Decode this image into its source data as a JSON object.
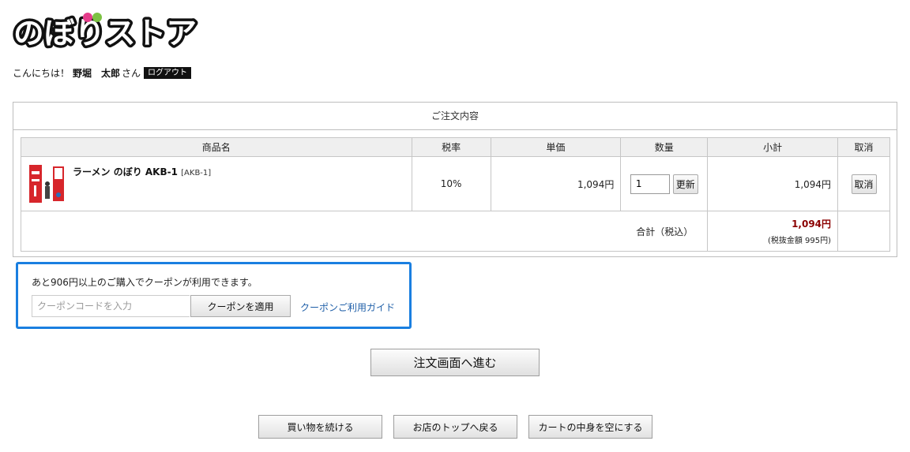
{
  "brand": {
    "logo_text": "のぼりストア"
  },
  "greeting": {
    "hello": "こんにちは！",
    "user_name": "野堀　太郎",
    "suffix": "さん",
    "logout_label": "ログアウト"
  },
  "order": {
    "section_title": "ご注文内容",
    "columns": [
      "商品名",
      "税率",
      "単価",
      "数量",
      "小計",
      "取消"
    ],
    "items": [
      {
        "name": "ラーメン のぼり AKB-1",
        "code": "[AKB-1]",
        "tax_rate": "10%",
        "unit_price": "1,094円",
        "quantity": "1",
        "update_label": "更新",
        "subtotal": "1,094円",
        "cancel_label": "取消"
      }
    ],
    "total_label": "合計（税込）",
    "total_price": "1,094円",
    "total_excl_tax": "(税抜金額 995円)"
  },
  "coupon": {
    "message": "あと906円以上のご購入でクーポンが利用できます。",
    "input_placeholder": "クーポンコードを入力",
    "apply_label": "クーポンを適用",
    "guide_link": "クーポンご利用ガイド"
  },
  "actions": {
    "proceed_label": "注文画面へ進む",
    "continue_shopping": "買い物を続ける",
    "back_to_top": "お店のトップへ戻る",
    "empty_cart": "カートの中身を空にする"
  },
  "colors": {
    "accent_blue": "#1a7fe0",
    "total_red": "#8b0000",
    "link_blue": "#1f5fa8"
  }
}
